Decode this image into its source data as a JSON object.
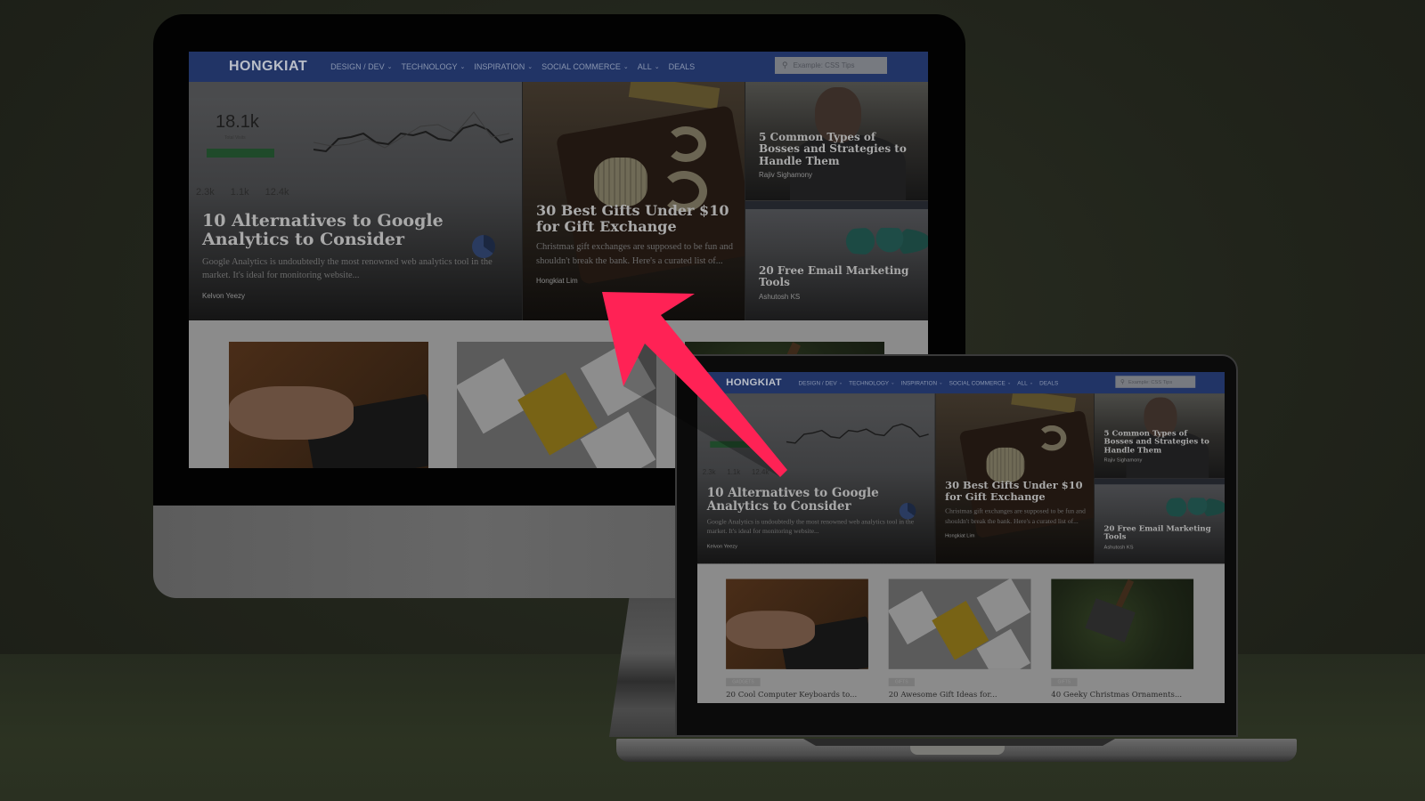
{
  "scene": {
    "description": "Responsive website mockup on iMac and MacBook",
    "arrow_color": "#ff2255"
  },
  "site": {
    "logo": "HONGKIAT",
    "brand_color": "#213466",
    "nav": [
      {
        "label": "DESIGN / DEV",
        "has_dropdown": true
      },
      {
        "label": "TECHNOLOGY",
        "has_dropdown": true
      },
      {
        "label": "INSPIRATION",
        "has_dropdown": true
      },
      {
        "label": "SOCIAL COMMERCE",
        "has_dropdown": true
      },
      {
        "label": "ALL",
        "has_dropdown": true
      },
      {
        "label": "DEALS",
        "has_dropdown": false
      }
    ],
    "chevron_glyph": "⌄",
    "search": {
      "placeholder": "Example: CSS Tips",
      "icon": "search-icon"
    },
    "featured": [
      {
        "title": "10 Alternatives to Google Analytics to Consider",
        "excerpt": "Google Analytics is undoubtedly the most renowned web analytics tool in the market. It's ideal for monitoring website...",
        "author": "Kelvon Yeezy"
      },
      {
        "title": "30 Best Gifts Under $10 for Gift Exchange",
        "excerpt": "Christmas gift exchanges are supposed to be fun and shouldn't break the bank. Here's a curated list of...",
        "author": "Hongkiat Lim"
      },
      {
        "title": "5 Common Types of Bosses and Strategies to Handle Them",
        "author": "Rajiv Sighamony"
      },
      {
        "title": "20 Free Email Marketing Tools",
        "author": "Ashutosh KS"
      }
    ],
    "dashboard_image": {
      "total_visits": "18.1k",
      "total_visits_label": "Total Visits",
      "stats": [
        "2.3k",
        "1.1k",
        "12.4k"
      ]
    },
    "grid": [
      {
        "category": "Gadgets",
        "title": "20 Cool Computer Keyboards to..."
      },
      {
        "category": "Gifts",
        "title": "20 Awesome Gift Ideas for..."
      },
      {
        "category": "Gifts",
        "title": "40 Geeky Christmas Ornaments..."
      }
    ]
  }
}
